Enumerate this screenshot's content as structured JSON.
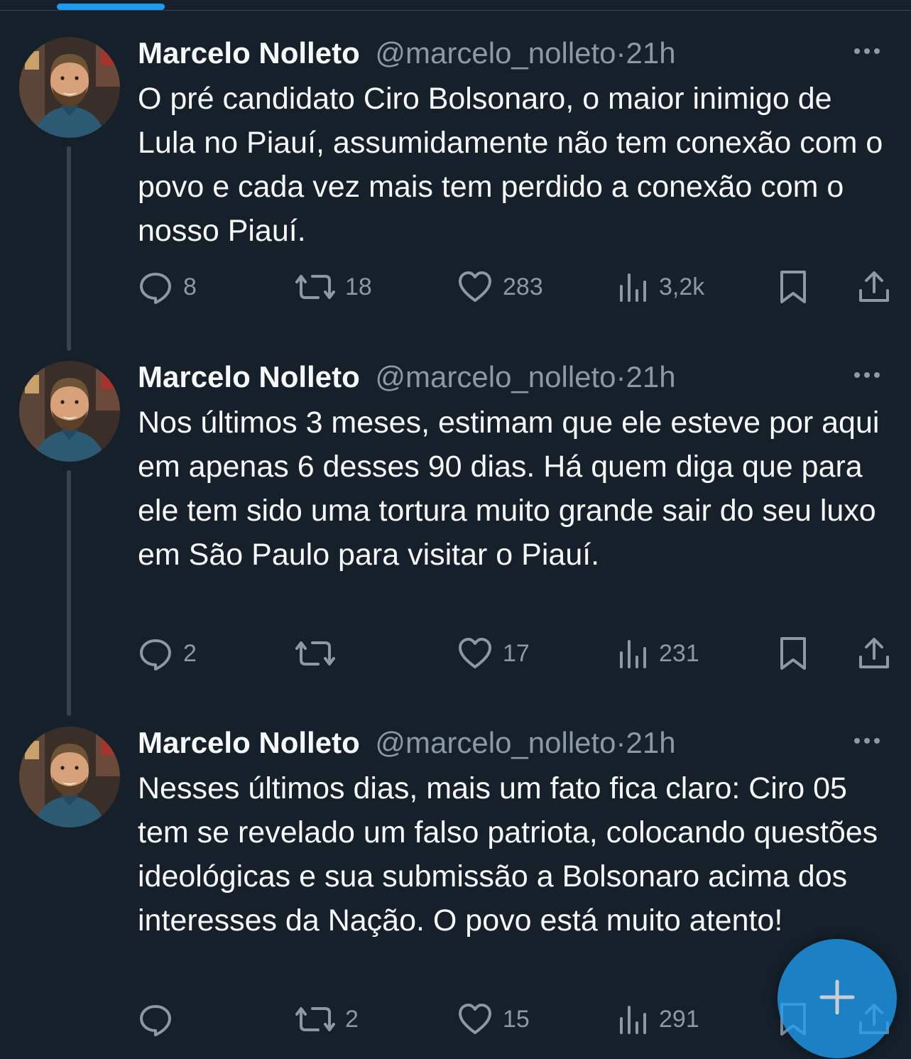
{
  "theme": {
    "background": "#15202b",
    "text": "#f7f9f9",
    "muted": "#8b98a5",
    "accent": "#1d9bf0"
  },
  "tweets": [
    {
      "name": "Marcelo Nolleto",
      "handle": "@marcelo_nolleto",
      "separator": "·",
      "time": "21h",
      "text": "O pré candidato Ciro Bolsonaro, o maior inimigo de Lula no Piauí, assumidamente não tem conexão com o povo e cada vez mais tem perdido a conexão com o nosso Piauí.",
      "replies": "8",
      "retweets": "18",
      "likes": "283",
      "views": "3,2k"
    },
    {
      "name": "Marcelo Nolleto",
      "handle": "@marcelo_nolleto",
      "separator": "·",
      "time": "21h",
      "text": "Nos últimos 3 meses, estimam que ele esteve por aqui em apenas 6 desses 90 dias. Há quem diga que para ele tem sido uma tortura muito grande sair do seu luxo em São Paulo para visitar o Piauí.",
      "replies": "2",
      "retweets": "",
      "likes": "17",
      "views": "231"
    },
    {
      "name": "Marcelo Nolleto",
      "handle": "@marcelo_nolleto",
      "separator": "·",
      "time": "21h",
      "text": "Nesses últimos dias, mais um fato fica claro: Ciro 05 tem se revelado um falso patriota, colocando questões ideológicas e sua submissão a Bolsonaro acima dos interesses da Nação. O povo está muito atento!",
      "replies": "",
      "retweets": "2",
      "likes": "15",
      "views": "291"
    }
  ],
  "icons": {
    "reply": "speech-bubble-icon",
    "retweet": "retweet-arrows-icon",
    "like": "heart-icon",
    "views": "bar-chart-icon",
    "bookmark": "bookmark-icon",
    "share": "share-upload-icon",
    "more": "more-dots-icon",
    "compose": "plus-icon"
  }
}
